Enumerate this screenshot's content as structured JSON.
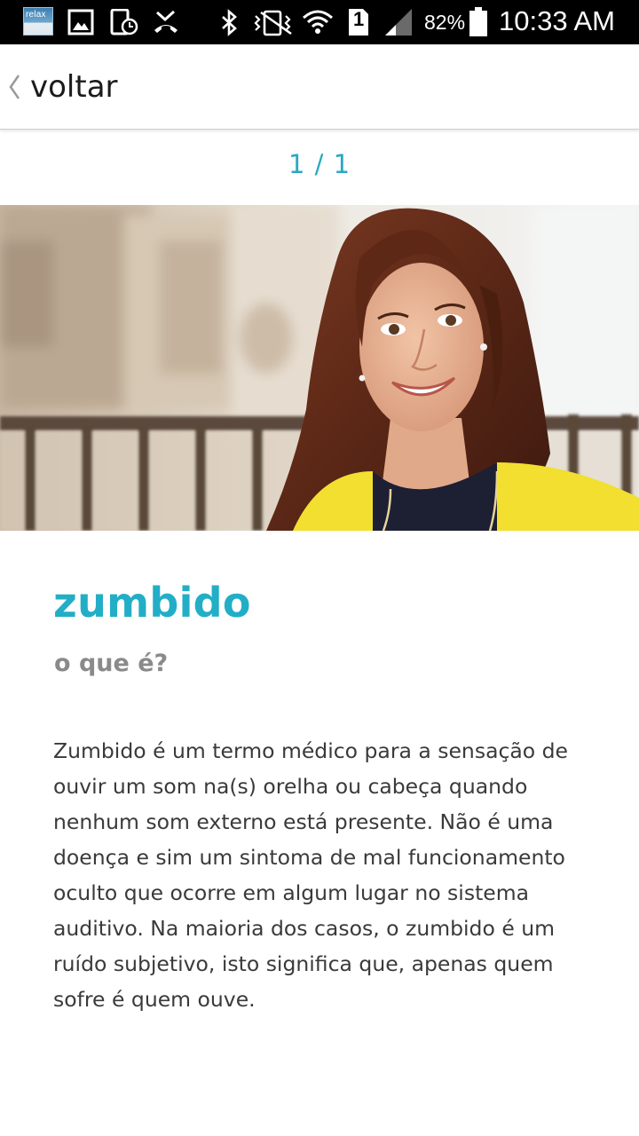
{
  "status_bar": {
    "app_icon_label": "relax",
    "battery": "82%",
    "time": "10:33 AM",
    "sim_number": "1",
    "icons": [
      "relax-app-icon",
      "gallery-icon",
      "device-timer-icon",
      "missed-call-icon",
      "bluetooth-icon",
      "vibrate-mute-icon",
      "wifi-icon",
      "sim-icon",
      "signal-icon",
      "battery-icon"
    ]
  },
  "topbar": {
    "back_label": "voltar",
    "back_icon": "chevron-left-icon"
  },
  "pager": {
    "text": "1 / 1"
  },
  "article": {
    "title": "zumbido",
    "subtitle": "o que é?",
    "body": "Zumbido é um termo médico para a sensação de ouvir um som na(s) orelha ou cabeça quando nenhum som externo está presente. Não é uma doença e sim um sintoma de mal funcionamento oculto que ocorre em algum lugar no sistema auditivo. Na maioria dos casos, o zumbido é um ruído subjetivo, isto significa que, apenas quem sofre é quem ouve."
  },
  "colors": {
    "accent": "#22aec6",
    "pager": "#29a9c0",
    "subtitle": "#8a8a8a",
    "body": "#3a3a3a",
    "status_bar": "#000000"
  }
}
